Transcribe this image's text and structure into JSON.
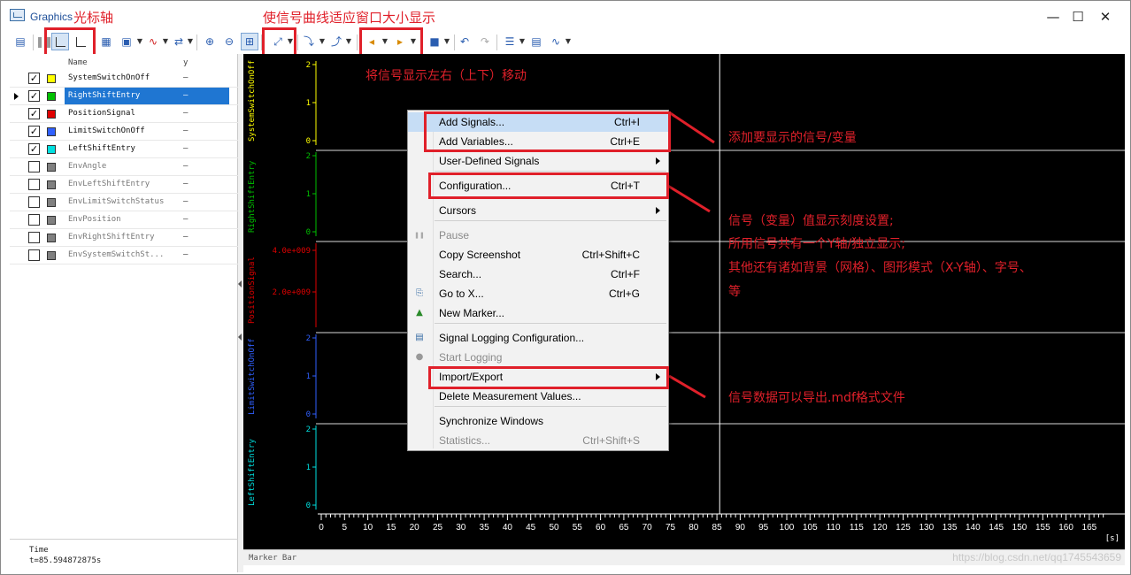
{
  "window": {
    "title": "Graphics",
    "title_annotation": "光标轴",
    "minimize_glyph": "—",
    "maximize_glyph": "☐",
    "close_glyph": "✕"
  },
  "annotations": {
    "fit_window": "使信号曲线适应窗口大小显示",
    "shift_display": "将信号显示左右（上下）移动",
    "add_signals": "添加要显示的信号/变量",
    "config_line1": "信号（变量）值显示刻度设置;",
    "config_line2": "所用信号共有一个Y轴/独立显示;",
    "config_line3": "其他还有诸如背景（网格）、图形模式（X-Y轴）、字号、",
    "config_line4": "等",
    "export": "信号数据可以导出.mdf格式文件"
  },
  "colors": {
    "annotation_red": "#e0202a",
    "selection_blue": "#1f76d2",
    "plot_background": "#000000",
    "signal_system_switch": "#ffff00",
    "signal_right_shift": "#00c000",
    "signal_position": "#e00000",
    "signal_limit_switch": "#3060ff",
    "signal_left_shift": "#00e0e0"
  },
  "signal_list": {
    "header_name": "Name",
    "header_y": "y",
    "rows": [
      {
        "name": "SystemSwitchOnOff",
        "y": "–",
        "checked": true,
        "color": "#ffff00"
      },
      {
        "name": "RightShiftEntry",
        "y": "–",
        "checked": true,
        "color": "#00c000"
      },
      {
        "name": "PositionSignal",
        "y": "–",
        "checked": true,
        "color": "#e00000"
      },
      {
        "name": "LimitSwitchOnOff",
        "y": "–",
        "checked": true,
        "color": "#3060ff"
      },
      {
        "name": "LeftShiftEntry",
        "y": "–",
        "checked": true,
        "color": "#00e0e0"
      },
      {
        "name": "EnvAngle",
        "y": "–",
        "checked": false,
        "color": "#808080"
      },
      {
        "name": "EnvLeftShiftEntry",
        "y": "–",
        "checked": false,
        "color": "#808080"
      },
      {
        "name": "EnvLimitSwitchStatus",
        "y": "–",
        "checked": false,
        "color": "#808080"
      },
      {
        "name": "EnvPosition",
        "y": "–",
        "checked": false,
        "color": "#808080"
      },
      {
        "name": "EnvRightShiftEntry",
        "y": "–",
        "checked": false,
        "color": "#808080"
      },
      {
        "name": "EnvSystemSwitchSt...",
        "y": "–",
        "checked": false,
        "color": "#808080"
      }
    ],
    "time_label": "Time",
    "time_value": "t=85.594872875s"
  },
  "plot": {
    "lanes": [
      {
        "name": "SystemSwitchOnOff",
        "color": "#ffff00",
        "ticks": [
          "2",
          "1",
          "0"
        ]
      },
      {
        "name": "RightShiftEntry",
        "color": "#00c000",
        "ticks": [
          "2",
          "1",
          "0"
        ]
      },
      {
        "name": "PositionSignal",
        "color": "#e00000",
        "ticks": [
          "4.0e+009",
          "2.0e+009"
        ]
      },
      {
        "name": "LimitSwitchOnOff",
        "color": "#3060ff",
        "ticks": [
          "2",
          "1",
          "0"
        ]
      },
      {
        "name": "LeftShiftEntry",
        "color": "#00e0e0",
        "ticks": [
          "2",
          "1",
          "0"
        ]
      }
    ],
    "x_ticks": [
      "0",
      "5",
      "10",
      "15",
      "20",
      "25",
      "30",
      "35",
      "40",
      "45",
      "50",
      "55",
      "60",
      "65",
      "70",
      "75",
      "80",
      "85",
      "90",
      "95",
      "100",
      "105",
      "110",
      "115",
      "120",
      "125",
      "130",
      "135",
      "140",
      "145",
      "150",
      "155",
      "160",
      "165"
    ],
    "x_unit": "[s]",
    "cursor_time": 85.594872875,
    "marker_bar_label": "Marker Bar"
  },
  "context_menu": {
    "items": [
      {
        "label": "Add Signals...",
        "shortcut": "Ctrl+I",
        "highlighted": true
      },
      {
        "label": "Add Variables...",
        "shortcut": "Ctrl+E"
      },
      {
        "label": "User-Defined Signals",
        "submenu": true
      },
      {
        "label": "Configuration...",
        "shortcut": "Ctrl+T"
      },
      {
        "label": "Cursors",
        "submenu": true
      },
      {
        "label": "Pause",
        "disabled": true
      },
      {
        "label": "Copy Screenshot",
        "shortcut": "Ctrl+Shift+C"
      },
      {
        "label": "Search...",
        "shortcut": "Ctrl+F"
      },
      {
        "label": "Go to X...",
        "shortcut": "Ctrl+G"
      },
      {
        "label": "New Marker..."
      },
      {
        "label": "Signal Logging Configuration..."
      },
      {
        "label": "Start Logging",
        "disabled": true
      },
      {
        "label": "Import/Export",
        "submenu": true
      },
      {
        "label": "Delete Measurement Values..."
      },
      {
        "label": "Synchronize Windows"
      },
      {
        "label": "Statistics...",
        "shortcut": "Ctrl+Shift+S",
        "disabled": true
      }
    ]
  },
  "watermark": "https://blog.csdn.net/qq1745543659"
}
